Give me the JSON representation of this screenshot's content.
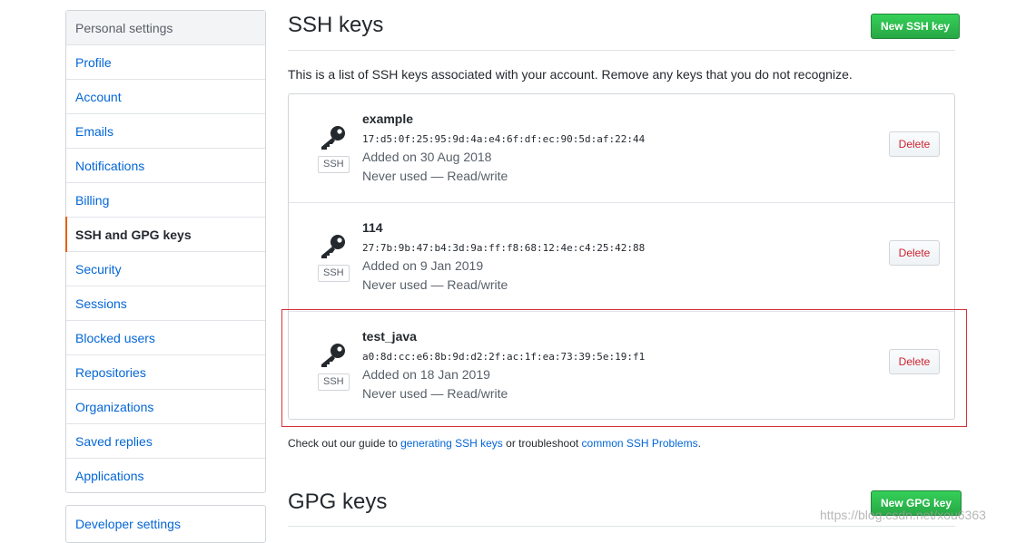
{
  "sidebar": {
    "header": "Personal settings",
    "items": [
      {
        "label": "Profile",
        "name": "sidebar-item-profile"
      },
      {
        "label": "Account",
        "name": "sidebar-item-account"
      },
      {
        "label": "Emails",
        "name": "sidebar-item-emails"
      },
      {
        "label": "Notifications",
        "name": "sidebar-item-notifications"
      },
      {
        "label": "Billing",
        "name": "sidebar-item-billing"
      },
      {
        "label": "SSH and GPG keys",
        "name": "sidebar-item-ssh-gpg-keys",
        "selected": true
      },
      {
        "label": "Security",
        "name": "sidebar-item-security"
      },
      {
        "label": "Sessions",
        "name": "sidebar-item-sessions"
      },
      {
        "label": "Blocked users",
        "name": "sidebar-item-blocked-users"
      },
      {
        "label": "Repositories",
        "name": "sidebar-item-repositories"
      },
      {
        "label": "Organizations",
        "name": "sidebar-item-organizations"
      },
      {
        "label": "Saved replies",
        "name": "sidebar-item-saved-replies"
      },
      {
        "label": "Applications",
        "name": "sidebar-item-applications"
      }
    ],
    "developer_settings": "Developer settings"
  },
  "ssh": {
    "title": "SSH keys",
    "new_button": "New SSH key",
    "description": "This is a list of SSH keys associated with your account. Remove any keys that you do not recognize.",
    "keys": [
      {
        "title": "example",
        "fingerprint": "17:d5:0f:25:95:9d:4a:e4:6f:df:ec:90:5d:af:22:44",
        "added": "Added on 30 Aug 2018",
        "usage": "Never used — Read/write",
        "badge": "SSH",
        "delete_label": "Delete"
      },
      {
        "title": "114",
        "fingerprint": "27:7b:9b:47:b4:3d:9a:ff:f8:68:12:4e:c4:25:42:88",
        "added": "Added on 9 Jan 2019",
        "usage": "Never used — Read/write",
        "badge": "SSH",
        "delete_label": "Delete"
      },
      {
        "title": "test_java",
        "fingerprint": "a0:8d:cc:e6:8b:9d:d2:2f:ac:1f:ea:73:39:5e:19:f1",
        "added": "Added on 18 Jan 2019",
        "usage": "Never used — Read/write",
        "badge": "SSH",
        "delete_label": "Delete"
      }
    ],
    "guide": {
      "prefix": "Check out our guide to ",
      "link1": "generating SSH keys",
      "middle": " or troubleshoot ",
      "link2": "common SSH Problems",
      "suffix": "."
    }
  },
  "gpg": {
    "title": "GPG keys",
    "new_button": "New GPG key"
  },
  "watermark": "https://blog.csdn.net/xou6363",
  "colors": {
    "accent_selected": "#e36209",
    "link": "#0366d6",
    "primary_button": "#28a745",
    "danger": "#cb2431",
    "highlight_border": "#d6323a"
  }
}
